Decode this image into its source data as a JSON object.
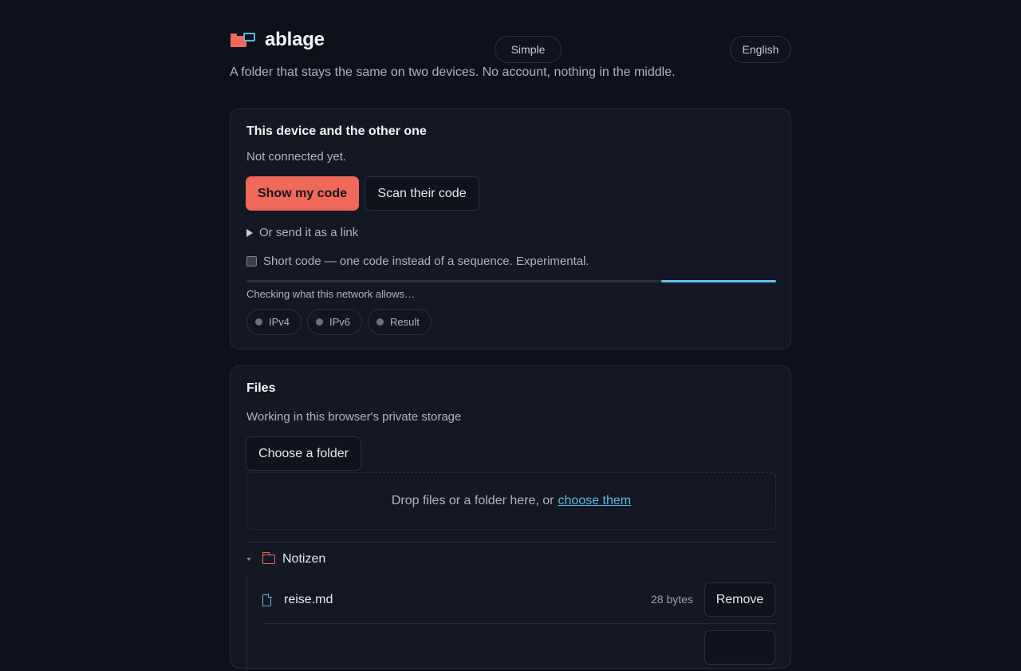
{
  "app": {
    "name": "ablage",
    "tagline": "A folder that stays the same on two devices. No account, nothing in the middle.",
    "mode": "Simple",
    "language": "English"
  },
  "connection": {
    "title": "This device and the other one",
    "status": "Not connected yet.",
    "show_code_label": "Show my code",
    "scan_code_label": "Scan their code",
    "link_disclosure": "Or send it as a link",
    "short_code_label": "Short code — one code instead of a sequence. Experimental.",
    "short_code_checked": false,
    "network_check_text": "Checking what this network allows…",
    "checks": [
      "IPv4",
      "IPv6",
      "Result"
    ]
  },
  "files": {
    "title": "Files",
    "storage_text": "Working in this browser's private storage",
    "choose_folder_label": "Choose a folder",
    "drop_text": "Drop files or a folder here, or",
    "drop_link": "choose them",
    "folder": {
      "name": "Notizen",
      "files": [
        {
          "name": "reise.md",
          "size": "28 bytes",
          "remove_label": "Remove"
        }
      ]
    }
  },
  "colors": {
    "accent": "#f0685a",
    "link": "#5fb8dc",
    "background": "#0d111b",
    "card": "#141824"
  }
}
